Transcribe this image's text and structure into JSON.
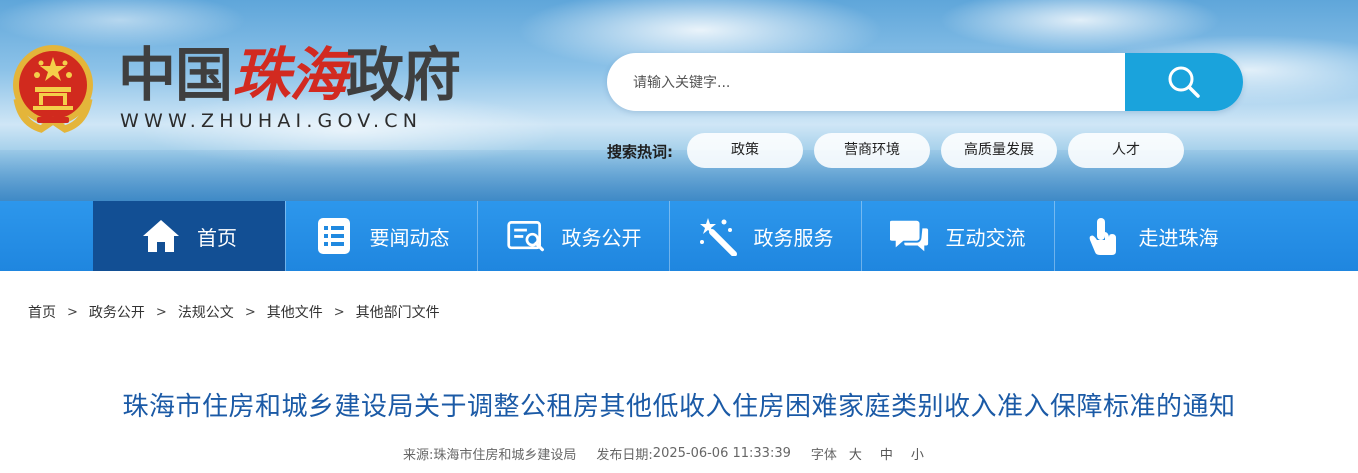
{
  "header": {
    "logo": {
      "part1": "中国",
      "part2": "珠海",
      "part3": "政府",
      "url_text": "WWW.ZHUHAI.GOV.CN"
    },
    "search": {
      "placeholder": "请输入关键字..."
    },
    "hot": {
      "label": "搜索热词:",
      "tags": [
        "政策",
        "营商环境",
        "高质量发展",
        "人才"
      ]
    }
  },
  "nav": {
    "items": [
      {
        "label": "首页",
        "icon": "home-icon"
      },
      {
        "label": "要闻动态",
        "icon": "news-list-icon"
      },
      {
        "label": "政务公开",
        "icon": "document-search-icon"
      },
      {
        "label": "政务服务",
        "icon": "magic-wand-icon"
      },
      {
        "label": "互动交流",
        "icon": "chat-bubbles-icon"
      },
      {
        "label": "走进珠海",
        "icon": "pointer-hand-icon"
      }
    ],
    "active_index": 0
  },
  "breadcrumb": [
    "首页",
    "政务公开",
    "法规公文",
    "其他文件",
    "其他部门文件"
  ],
  "article": {
    "title": "珠海市住房和城乡建设局关于调整公租房其他低收入住房困难家庭类别收入准入保障标准的通知",
    "source_label": "来源:",
    "source": "珠海市住房和城乡建设局",
    "date_label": "发布日期:",
    "date": "2025-06-06 11:33:39",
    "font_label": "字体",
    "font_sizes": [
      "大",
      "中",
      "小"
    ]
  },
  "colors": {
    "nav_bg": "#1f86df",
    "nav_active": "#124f94",
    "title": "#1b5aa6",
    "search_btn": "#1aa3dc",
    "logo_red": "#d22a20"
  }
}
